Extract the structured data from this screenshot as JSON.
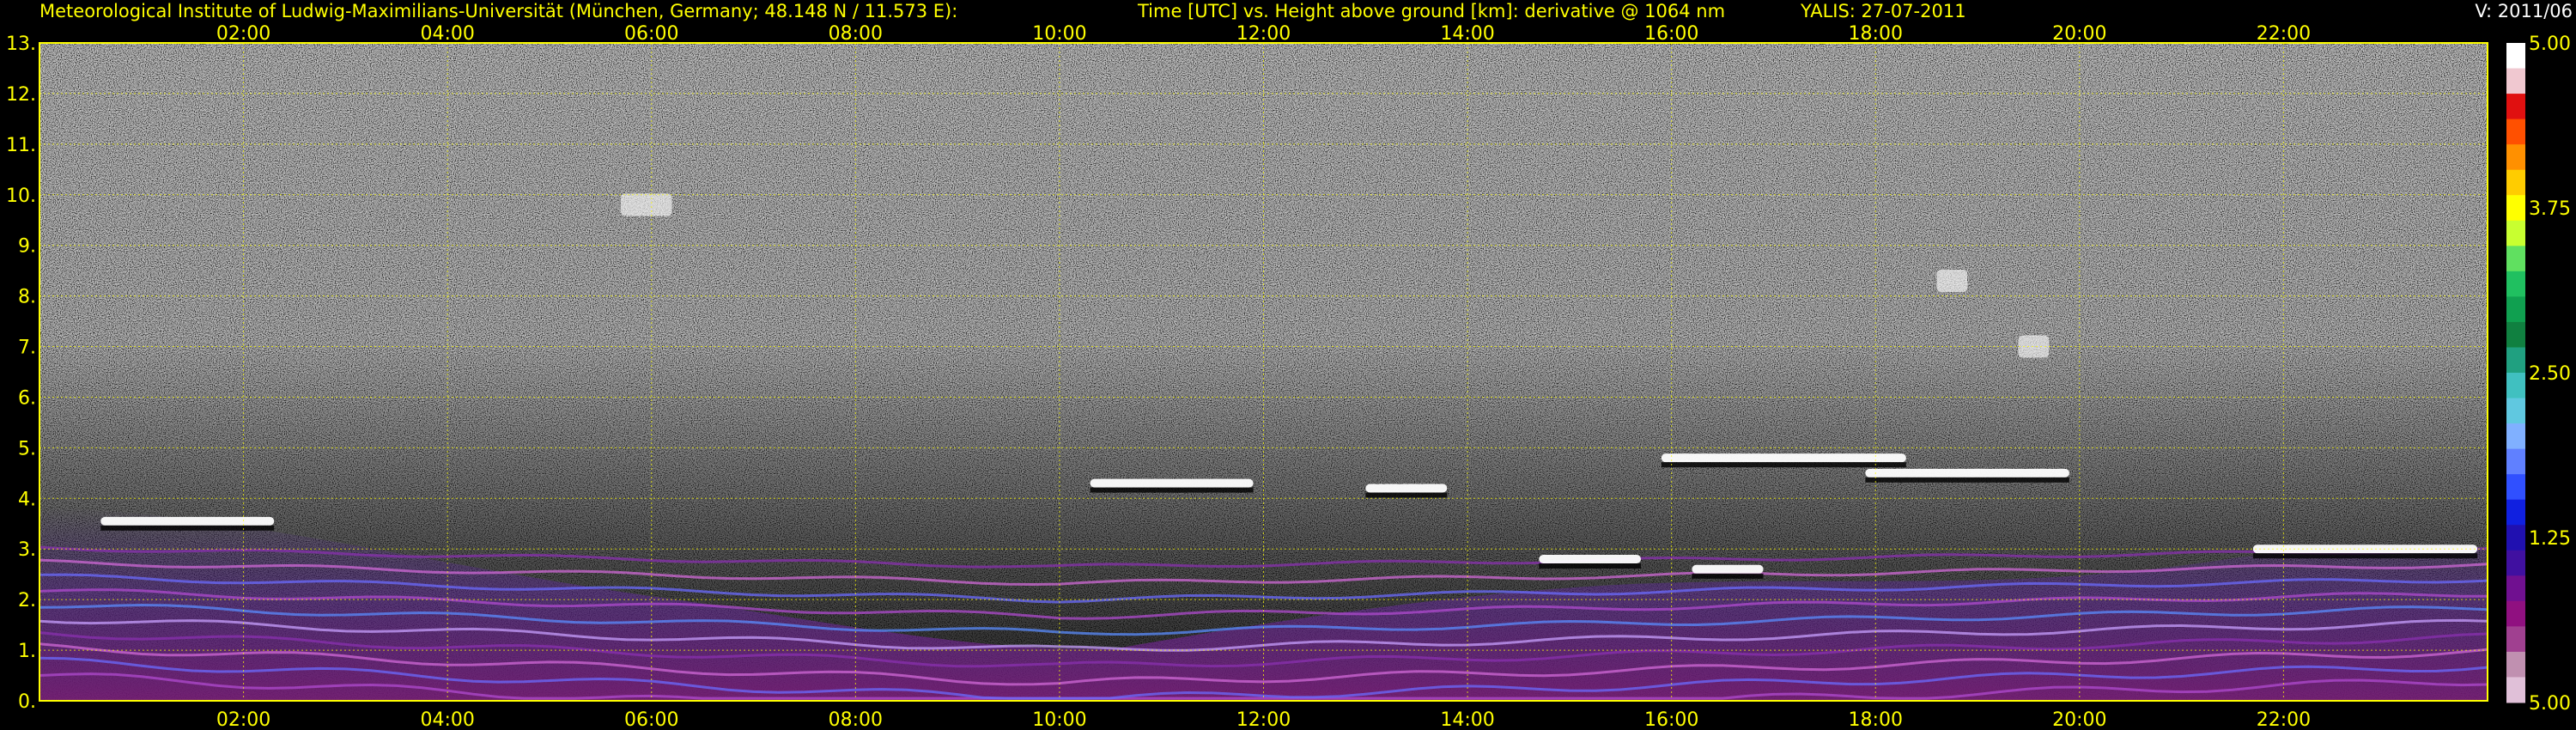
{
  "header": {
    "institute": "Meteorological Institute of Ludwig-Maximilians-Universität (München, Germany; 48.148 N / 11.573 E):",
    "description": "Time [UTC] vs. Height above ground [km]: derivative @ 1064 nm",
    "system": "YALIS: 27-07-2011",
    "version": "V: 2011/06"
  },
  "colors": {
    "label": "#ffff00",
    "grid": "#ffff00",
    "background": "#000000"
  },
  "chart_data": {
    "type": "heatmap",
    "title": "Time [UTC] vs. Height above ground [km]: derivative @ 1064 nm",
    "xlabel": "Time [UTC]",
    "ylabel": "Height above ground [km]",
    "x_range_hours": [
      0,
      24
    ],
    "ylim": [
      0,
      13
    ],
    "x_ticks": [
      "02:00",
      "04:00",
      "06:00",
      "08:00",
      "10:00",
      "12:00",
      "14:00",
      "16:00",
      "18:00",
      "20:00",
      "22:00"
    ],
    "x_tick_hours": [
      2,
      4,
      6,
      8,
      10,
      12,
      14,
      16,
      18,
      20,
      22
    ],
    "y_ticks": [
      "0.",
      "1.",
      "2.",
      "3.",
      "4.",
      "5.",
      "6.",
      "7.",
      "8.",
      "9.",
      "10.",
      "11.",
      "12.",
      "13."
    ],
    "y_tick_values": [
      0,
      1,
      2,
      3,
      4,
      5,
      6,
      7,
      8,
      9,
      10,
      11,
      12,
      13
    ],
    "grid": true,
    "colorbar": {
      "labels": [
        "5.00",
        "3.75",
        "2.50",
        "1.25",
        "5.00"
      ],
      "colors": [
        "#ffffff",
        "#f0c8d0",
        "#e01010",
        "#ff5000",
        "#ff9000",
        "#ffcc00",
        "#ffff00",
        "#c8ff30",
        "#60e060",
        "#20c060",
        "#10a050",
        "#108040",
        "#20a080",
        "#40c0c0",
        "#60c8e0",
        "#80b0ff",
        "#6080ff",
        "#3050ff",
        "#1020e0",
        "#2010b0",
        "#4010a0",
        "#701090",
        "#901080",
        "#a04090",
        "#c090b0",
        "#e0c0d8"
      ]
    },
    "features": [
      {
        "name": "cloud layer",
        "hours": [
          0.6,
          2.3
        ],
        "height_km": 3.55
      },
      {
        "name": "cloud layer",
        "hours": [
          10.3,
          11.9
        ],
        "height_km": 4.3
      },
      {
        "name": "cloud layer",
        "hours": [
          13.0,
          13.8
        ],
        "height_km": 4.2
      },
      {
        "name": "cloud layer",
        "hours": [
          14.7,
          15.7
        ],
        "height_km": 2.8
      },
      {
        "name": "cloud layer",
        "hours": [
          16.2,
          16.9
        ],
        "height_km": 2.6
      },
      {
        "name": "cloud layer",
        "hours": [
          15.9,
          18.3
        ],
        "height_km": 4.8
      },
      {
        "name": "cloud layer",
        "hours": [
          17.9,
          19.9
        ],
        "height_km": 4.5
      },
      {
        "name": "cloud layer",
        "hours": [
          21.7,
          23.9
        ],
        "height_km": 3.0
      },
      {
        "name": "cirrus patch",
        "hours": [
          5.7,
          6.2
        ],
        "height_km": 9.8
      },
      {
        "name": "cirrus patch",
        "hours": [
          18.6,
          18.9
        ],
        "height_km": 8.3
      },
      {
        "name": "cirrus patch",
        "hours": [
          19.4,
          19.7
        ],
        "height_km": 7.0
      }
    ]
  }
}
